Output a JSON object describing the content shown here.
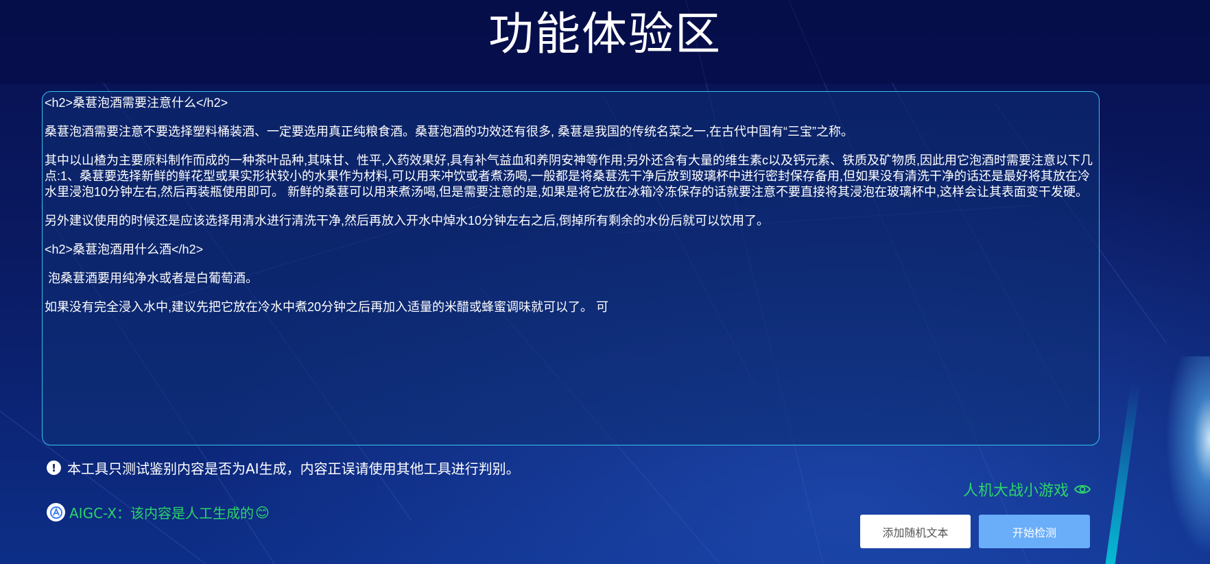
{
  "page": {
    "title": "功能体验区"
  },
  "editor": {
    "paragraphs": [
      "<h2>桑葚泡酒需要注意什么</h2>",
      "桑葚泡酒需要注意不要选择塑料桶装酒、一定要选用真正纯粮食酒。桑葚泡酒的功效还有很多, 桑葚是我国的传统名菜之一,在古代中国有“三宝”之称。",
      "其中以山楂为主要原料制作而成的一种茶叶品种,其味甘、性平,入药效果好,具有补气益血和养阴安神等作用;另外还含有大量的维生素c以及钙元素、铁质及矿物质,因此用它泡酒时需要注意以下几点:1、桑葚要选择新鲜的鲜花型或果实形状较小的水果作为材料,可以用来冲饮或者煮汤喝,一般都是将桑葚洗干净后放到玻璃杯中进行密封保存备用,但如果没有清洗干净的话还是最好将其放在冷水里浸泡10分钟左右,然后再装瓶使用即可。 新鲜的桑葚可以用来煮汤喝,但是需要注意的是,如果是将它放在冰箱冷冻保存的话就要注意不要直接将其浸泡在玻璃杯中,这样会让其表面变干发硬。",
      "另外建议使用的时候还是应该选择用清水进行清洗干净,然后再放入开水中焯水10分钟左右之后,倒掉所有剩余的水份后就可以饮用了。",
      "",
      "<h2>桑葚泡酒用什么酒</h2>",
      " 泡桑葚酒要用纯净水或者是白葡萄酒。",
      "如果没有完全浸入水中,建议先把它放在冷水中煮20分钟之后再加入适量的米醋或蜂蜜调味就可以了。 可"
    ]
  },
  "notice": {
    "icon": "exclamation-icon",
    "text": "本工具只测试鉴别内容是否为AI生成，内容正误请使用其他工具进行判别。"
  },
  "result": {
    "icon": "aigc-logo-icon",
    "text": "AIGC-X：该内容是人工生成的",
    "emoji": "😊",
    "color": "#2cd46a"
  },
  "game_link": {
    "label": "人机大战小游戏",
    "icon": "eye-icon"
  },
  "buttons": {
    "random_label": "添加随机文本",
    "start_label": "开始检测"
  },
  "colors": {
    "accent_green": "#2cd46a",
    "border_cyan": "#36c3ee",
    "start_button": "#6aaef9"
  }
}
